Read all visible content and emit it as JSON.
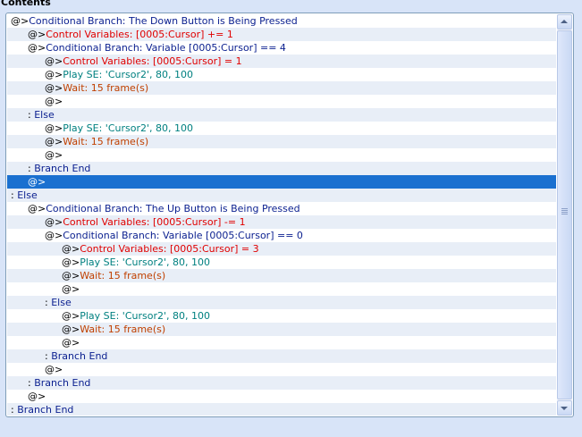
{
  "header": {
    "title": "Contents"
  },
  "colors": {
    "panel_bg": "#ffffff",
    "alt_row": "#e8eef7",
    "selection": "#1a70d0",
    "keyword_blue": "#0a1f8f",
    "variable_red": "#e00000",
    "se_teal": "#008080",
    "wait_brown": "#c04000"
  },
  "selected_line": 12,
  "lines": [
    {
      "indent": 0,
      "prefix": "@>",
      "text": "Conditional Branch: The Down Button is Being Pressed",
      "kind": "blue"
    },
    {
      "indent": 1,
      "prefix": "@>",
      "text": "Control Variables: [0005:Cursor] += 1",
      "kind": "red"
    },
    {
      "indent": 1,
      "prefix": "@>",
      "text": "Conditional Branch: Variable [0005:Cursor] == 4",
      "kind": "blue"
    },
    {
      "indent": 2,
      "prefix": "@>",
      "text": "Control Variables: [0005:Cursor] = 1",
      "kind": "red"
    },
    {
      "indent": 2,
      "prefix": "@>",
      "text": "Play SE: 'Cursor2', 80, 100",
      "kind": "teal"
    },
    {
      "indent": 2,
      "prefix": "@>",
      "text": "Wait: 15 frame(s)",
      "kind": "brown"
    },
    {
      "indent": 2,
      "prefix": "@>",
      "text": "",
      "kind": "blue"
    },
    {
      "indent": 1,
      "prefix": " :  ",
      "text": "Else",
      "kind": "blue"
    },
    {
      "indent": 2,
      "prefix": "@>",
      "text": "Play SE: 'Cursor2', 80, 100",
      "kind": "teal"
    },
    {
      "indent": 2,
      "prefix": "@>",
      "text": "Wait: 15 frame(s)",
      "kind": "brown"
    },
    {
      "indent": 2,
      "prefix": "@>",
      "text": "",
      "kind": "blue"
    },
    {
      "indent": 1,
      "prefix": " :  ",
      "text": "Branch End",
      "kind": "blue"
    },
    {
      "indent": 1,
      "prefix": "@>",
      "text": "",
      "kind": "blue"
    },
    {
      "indent": 0,
      "prefix": " :  ",
      "text": "Else",
      "kind": "blue"
    },
    {
      "indent": 1,
      "prefix": "@>",
      "text": "Conditional Branch: The Up Button is Being Pressed",
      "kind": "blue"
    },
    {
      "indent": 2,
      "prefix": "@>",
      "text": "Control Variables: [0005:Cursor] -= 1",
      "kind": "red"
    },
    {
      "indent": 2,
      "prefix": "@>",
      "text": "Conditional Branch: Variable [0005:Cursor] == 0",
      "kind": "blue"
    },
    {
      "indent": 3,
      "prefix": "@>",
      "text": "Control Variables: [0005:Cursor] = 3",
      "kind": "red"
    },
    {
      "indent": 3,
      "prefix": "@>",
      "text": "Play SE: 'Cursor2', 80, 100",
      "kind": "teal"
    },
    {
      "indent": 3,
      "prefix": "@>",
      "text": "Wait: 15 frame(s)",
      "kind": "brown"
    },
    {
      "indent": 3,
      "prefix": "@>",
      "text": "",
      "kind": "blue"
    },
    {
      "indent": 2,
      "prefix": " :  ",
      "text": "Else",
      "kind": "blue"
    },
    {
      "indent": 3,
      "prefix": "@>",
      "text": "Play SE: 'Cursor2', 80, 100",
      "kind": "teal"
    },
    {
      "indent": 3,
      "prefix": "@>",
      "text": "Wait: 15 frame(s)",
      "kind": "brown"
    },
    {
      "indent": 3,
      "prefix": "@>",
      "text": "",
      "kind": "blue"
    },
    {
      "indent": 2,
      "prefix": " :  ",
      "text": "Branch End",
      "kind": "blue"
    },
    {
      "indent": 2,
      "prefix": "@>",
      "text": "",
      "kind": "blue"
    },
    {
      "indent": 1,
      "prefix": " :  ",
      "text": "Branch End",
      "kind": "blue"
    },
    {
      "indent": 1,
      "prefix": "@>",
      "text": "",
      "kind": "blue"
    },
    {
      "indent": 0,
      "prefix": " :  ",
      "text": "Branch End",
      "kind": "blue"
    }
  ],
  "scrollbar": {
    "up_icon": "arrow-up-icon",
    "down_icon": "arrow-down-icon",
    "grip_icon": "grip-icon"
  }
}
